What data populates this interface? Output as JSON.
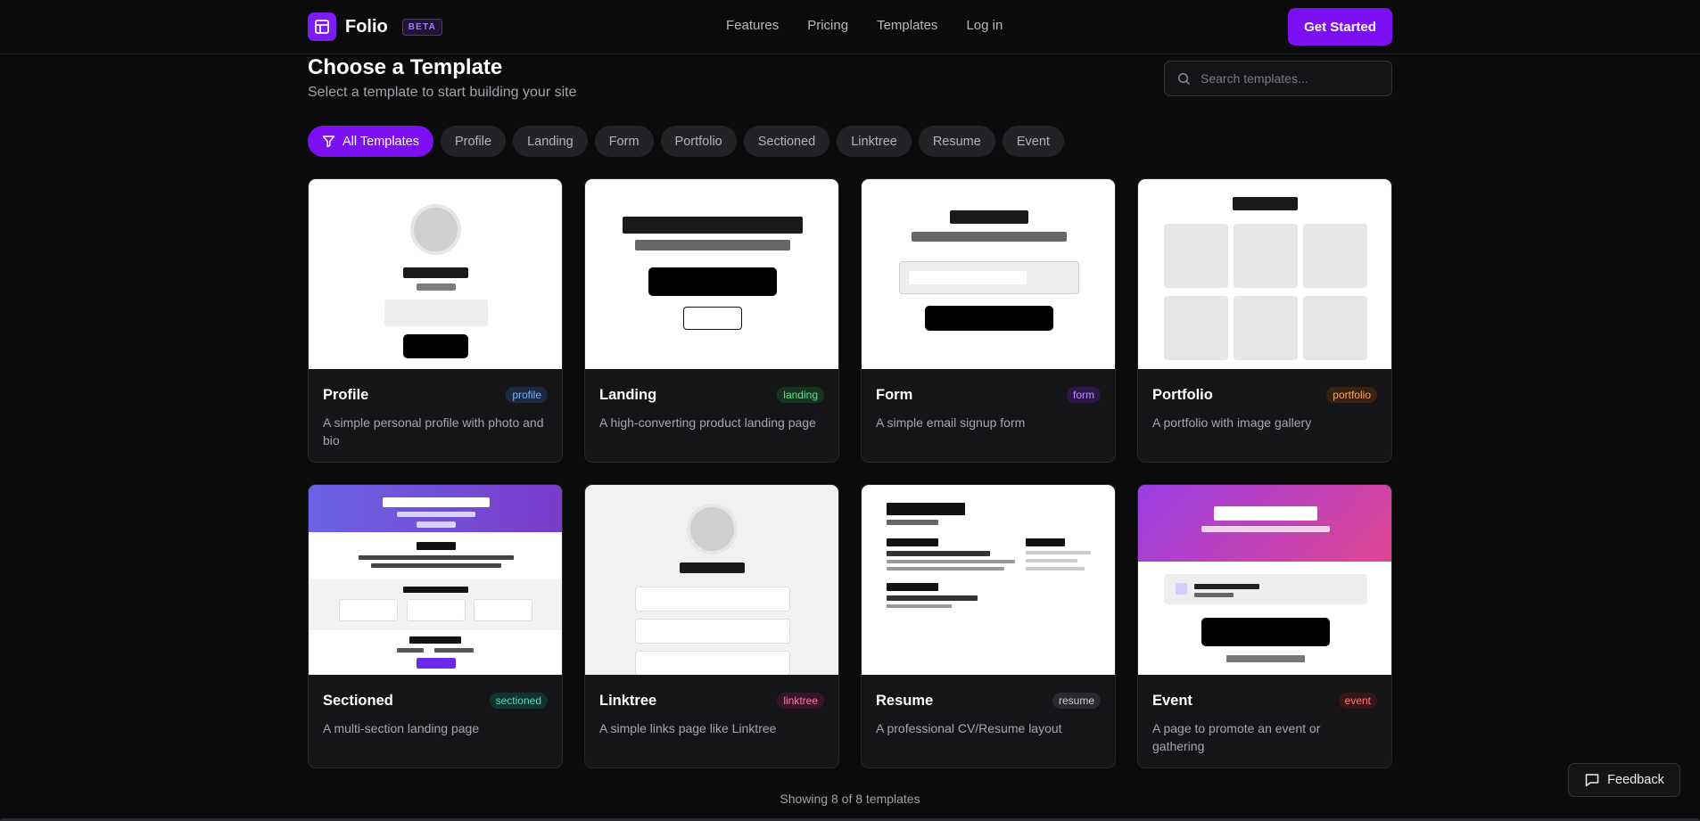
{
  "header": {
    "brand": "Folio",
    "beta_label": "BETA",
    "nav": [
      "Features",
      "Pricing",
      "Templates",
      "Log in"
    ],
    "cta_label": "Get Started"
  },
  "page": {
    "title": "Choose a Template",
    "subtitle": "Select a template to start building your site"
  },
  "search": {
    "placeholder": "Search templates..."
  },
  "filters": [
    "All Templates",
    "Profile",
    "Landing",
    "Form",
    "Portfolio",
    "Sectioned",
    "Linktree",
    "Resume",
    "Event"
  ],
  "templates": [
    {
      "title": "Profile",
      "tag": "profile",
      "description": "A simple personal profile with photo and bio"
    },
    {
      "title": "Landing",
      "tag": "landing",
      "description": "A high-converting product landing page"
    },
    {
      "title": "Form",
      "tag": "form",
      "description": "A simple email signup form"
    },
    {
      "title": "Portfolio",
      "tag": "portfolio",
      "description": "A portfolio with image gallery"
    },
    {
      "title": "Sectioned",
      "tag": "sectioned",
      "description": "A multi-section landing page"
    },
    {
      "title": "Linktree",
      "tag": "linktree",
      "description": "A simple links page like Linktree"
    },
    {
      "title": "Resume",
      "tag": "resume",
      "description": "A professional CV/Resume layout"
    },
    {
      "title": "Event",
      "tag": "event",
      "description": "A page to promote an event or gathering"
    }
  ],
  "footer": {
    "count_text": "Showing 8 of 8 templates",
    "feedback_label": "Feedback"
  },
  "colors": {
    "accent": "#7c10f2",
    "background": "#0b0b0c",
    "card": "#151518"
  }
}
